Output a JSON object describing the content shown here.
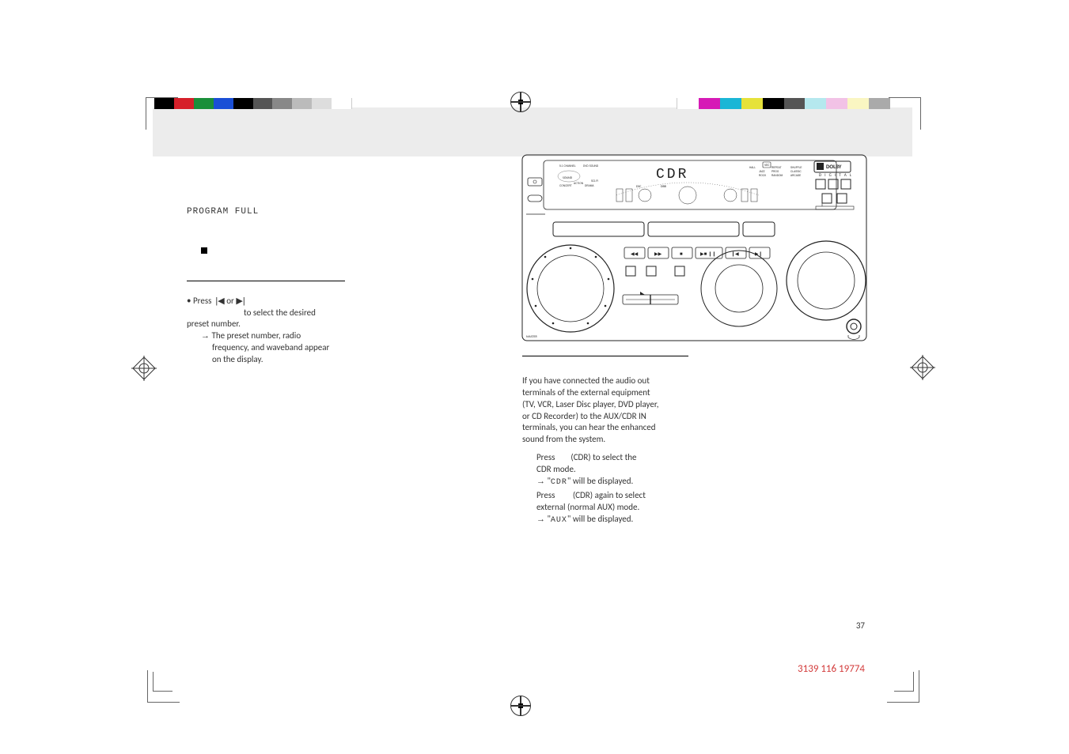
{
  "left_column": {
    "program_full": "PROGRAM FULL",
    "stop_marker_alt": "stop",
    "press_label": "Press",
    "or_label": "or",
    "to_select": "to select the desired",
    "preset_number_line": "preset number.",
    "result_line1": "The preset number, radio",
    "result_line2": "frequency, and waveband appear",
    "result_line3": "on the display."
  },
  "right_column": {
    "intro1": "If you have connected the audio out",
    "intro2": "terminals of the external equipment",
    "intro3": "(TV, VCR, Laser Disc player, DVD player,",
    "intro4": "or CD Recorder) to the AUX/CDR IN",
    "intro5": "terminals, you can hear the enhanced",
    "intro6": "sound from the system.",
    "step1a": "Press",
    "step1b": "(CDR) to select the",
    "step1c": "CDR mode.",
    "step1_res_prefix": "\"",
    "step1_res_value": "CDR",
    "step1_res_suffix": "\" will be displayed.",
    "step2a": "Press",
    "step2b": "(CDR) again to select",
    "step2c": "external (normal AUX) mode.",
    "step2_res_value": "AUX",
    "step2_res_suffix": "\" will be displayed."
  },
  "display_text": "CDR",
  "dolby_text": "DOLBY",
  "dolby_sub": "D I G I T A L",
  "page_number": "37",
  "part_number": "3139 116 19774",
  "colors": {
    "red": "#d6202a",
    "green": "#1a8f3a",
    "blue": "#1a4fd6",
    "cyan": "#1ab6d6",
    "magenta": "#d61ab6",
    "yellow": "#e6e23a",
    "black": "#000000",
    "grey70": "#555555",
    "grey50": "#888888",
    "grey30": "#bbbbbb",
    "grey15": "#dddddd",
    "white": "#ffffff",
    "lightcyan": "#b5e8ee",
    "lightmagenta": "#f2c2e6",
    "lightyellow": "#faf6c2"
  }
}
